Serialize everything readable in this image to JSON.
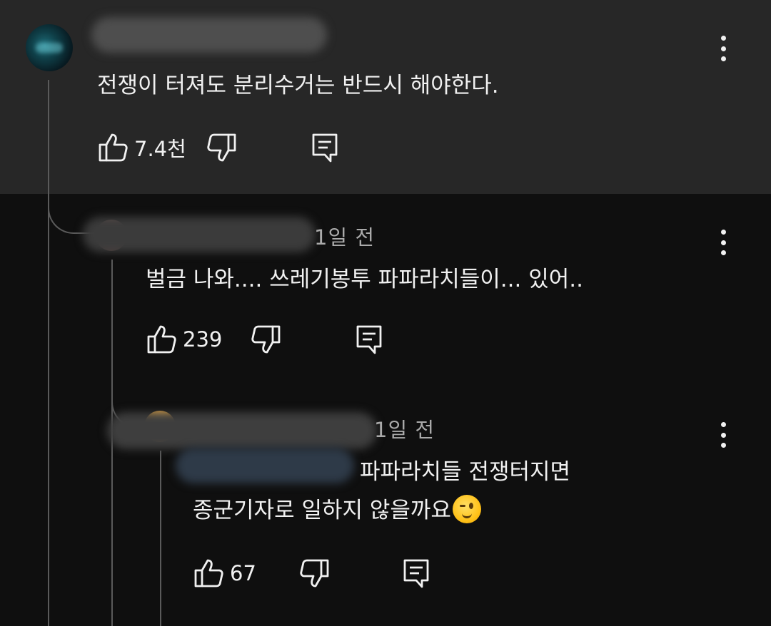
{
  "comments": [
    {
      "text": "전쟁이 터져도 분리수거는 반드시 해야한다.",
      "likes": "7.4천"
    },
    {
      "time": "1일 전",
      "text": "벌금 나와.... 쓰레기봉투 파파라치들이... 있어..",
      "likes": "239"
    },
    {
      "time": "1일 전",
      "text_line1": "파파라치들 전쟁터지면",
      "text_line2": "종군기자로 일하지 않을까요",
      "emoji": "wink-emoji",
      "likes": "67"
    }
  ],
  "icons": {
    "like": "thumbs-up-icon",
    "dislike": "thumbs-down-icon",
    "reply": "reply-icon",
    "menu": "more-vertical-icon"
  },
  "colors": {
    "background": "#0f0f0f",
    "highlighted_background": "#272727",
    "text": "#f1f1f1",
    "secondary_text": "#aaaaaa",
    "thread_line": "#5a5a5a"
  }
}
